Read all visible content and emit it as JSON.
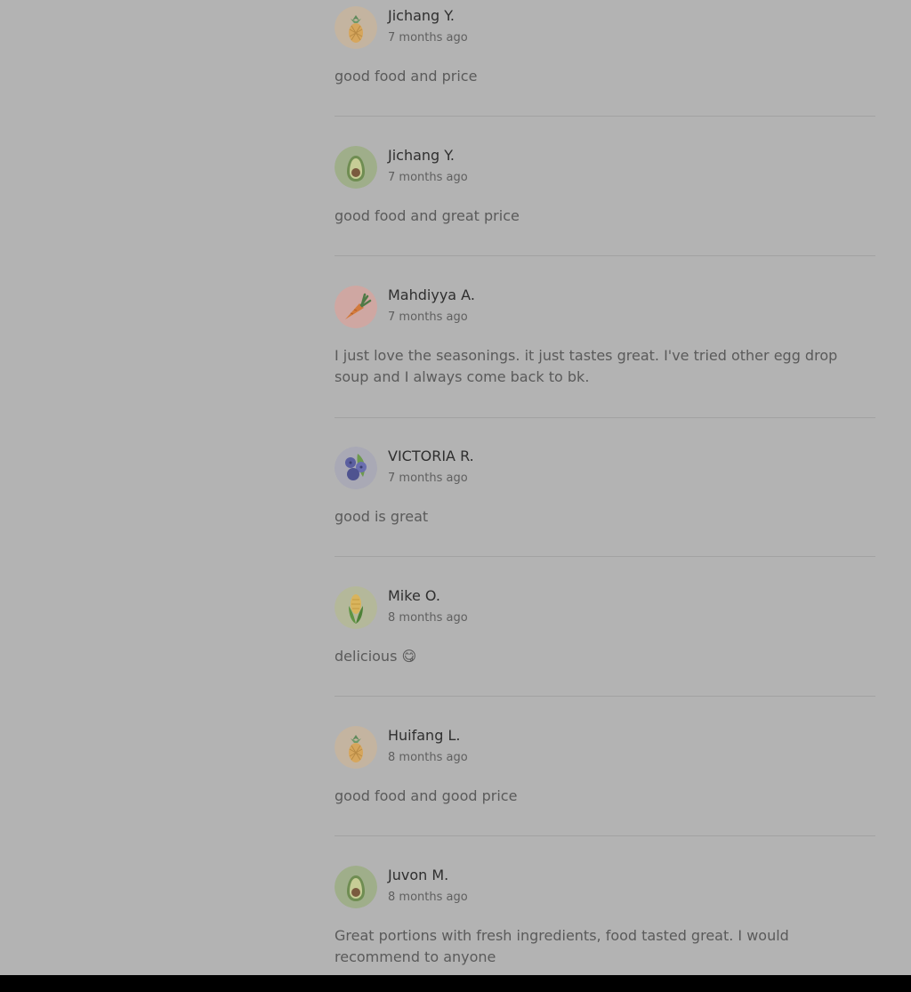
{
  "reviews": [
    {
      "name": "Jichang Y.",
      "time": "7 months ago",
      "text": "good food and price",
      "avatar": "pineapple-icon"
    },
    {
      "name": "Jichang Y.",
      "time": "7 months ago",
      "text": "good food and great price",
      "avatar": "avocado-icon"
    },
    {
      "name": "Mahdiyya A.",
      "time": "7 months ago",
      "text": "I just love the seasonings. it just tastes great. I've tried other egg drop soup and I always come back to bk.",
      "avatar": "carrot-icon"
    },
    {
      "name": "VICTORIA R.",
      "time": "7 months ago",
      "text": "good is great",
      "avatar": "blueberry-icon"
    },
    {
      "name": "Mike O.",
      "time": "8 months ago",
      "text": "delicious 😋",
      "avatar": "corn-icon"
    },
    {
      "name": "Huifang L.",
      "time": "8 months ago",
      "text": "good food and good price",
      "avatar": "pineapple-icon"
    },
    {
      "name": "Juvon M.",
      "time": "8 months ago",
      "text": "Great portions with fresh ingredients, food tasted great. I would recommend to anyone",
      "avatar": "avocado-icon"
    }
  ],
  "colors": {
    "overlay_background": "#b3b3b3",
    "name_text": "#2f2f2f",
    "body_text": "#5a5a5a",
    "divider": "#a2a2a2"
  }
}
